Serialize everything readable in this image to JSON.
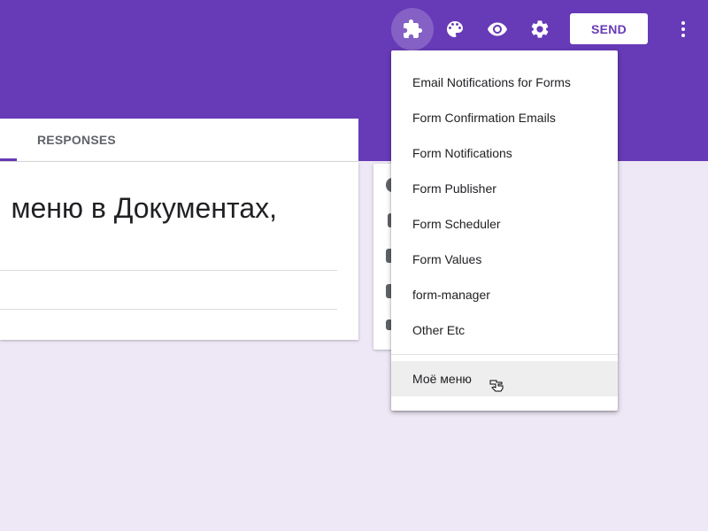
{
  "header": {
    "send_label": "SEND",
    "icons": [
      "add-ons-icon",
      "palette-icon",
      "preview-eye-icon",
      "settings-gear-icon",
      "more-vert-icon"
    ],
    "color": "#673ab7"
  },
  "tabs": {
    "responses_label": "RESPONSES"
  },
  "form": {
    "title_partial": "меню в Документах,"
  },
  "addons_menu": {
    "items": [
      {
        "label": "Email Notifications for Forms"
      },
      {
        "label": "Form Confirmation Emails"
      },
      {
        "label": "Form Notifications"
      },
      {
        "label": "Form Publisher"
      },
      {
        "label": "Form Scheduler"
      },
      {
        "label": "Form Values"
      },
      {
        "label": "form-manager"
      },
      {
        "label": "Other Etc"
      }
    ],
    "highlighted_item": "Моё меню"
  },
  "colors": {
    "accent": "#673ab7",
    "page_background": "#ede7f6",
    "menu_highlight": "#eeeeee"
  }
}
